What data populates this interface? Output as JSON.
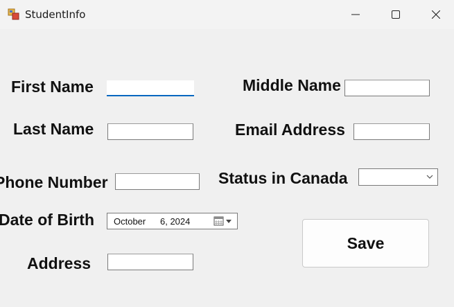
{
  "window": {
    "title": "StudentInfo",
    "app_icon": "winforms-app-icon",
    "controls": {
      "minimize_icon": "minimize-icon",
      "maximize_icon": "maximize-icon",
      "close_icon": "close-icon"
    }
  },
  "form": {
    "first_name": {
      "label": "First Name",
      "value": ""
    },
    "middle_name": {
      "label": "Middle Name",
      "value": ""
    },
    "last_name": {
      "label": "Last Name",
      "value": ""
    },
    "email_address": {
      "label": "Email Address",
      "value": ""
    },
    "phone_number": {
      "label": "Phone Number",
      "value": ""
    },
    "status_in_canada": {
      "label": "Status in Canada",
      "selected": ""
    },
    "date_of_birth": {
      "label": "Date of Birth",
      "month": "October",
      "day_year": "6, 2024",
      "button_icon": "calendar-dropdown-icon"
    },
    "address": {
      "label": "Address",
      "value": ""
    },
    "save_label": "Save"
  },
  "colors": {
    "focus_underline": "#0067c0",
    "window_bg": "#f0f0f0",
    "input_border": "#7a7a7a"
  }
}
